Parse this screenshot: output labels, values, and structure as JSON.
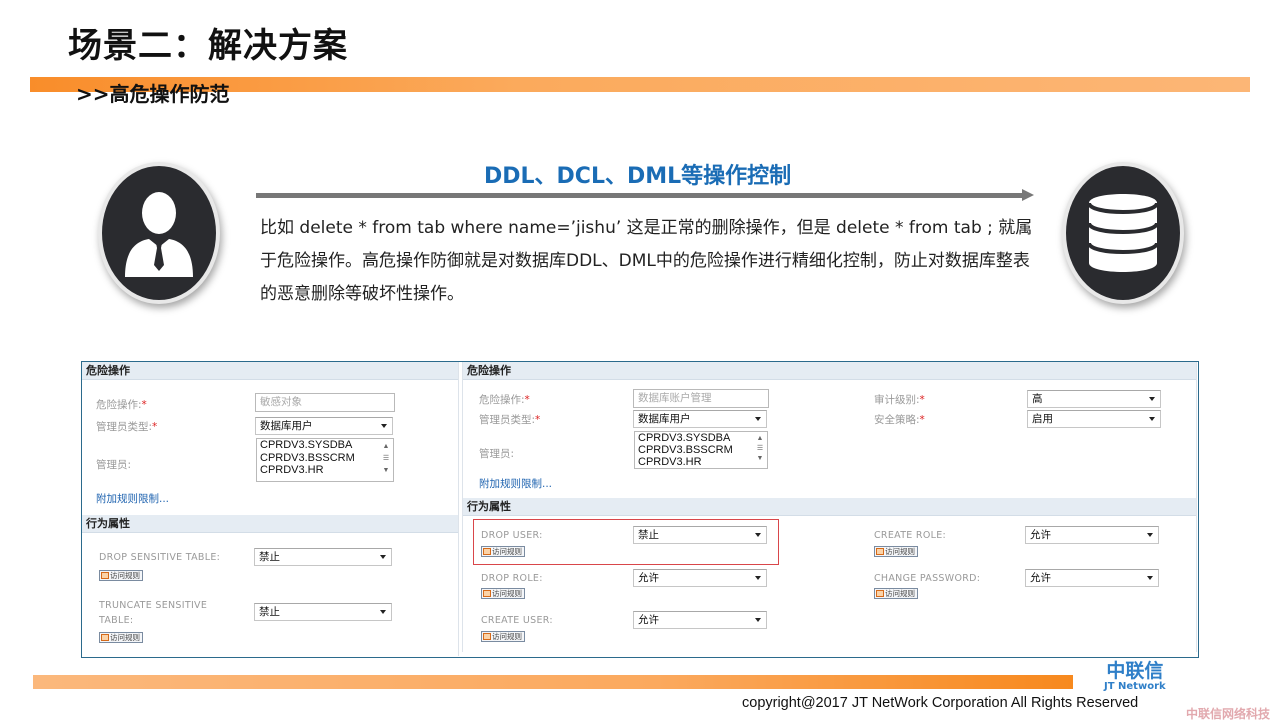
{
  "slide": {
    "title": "场景二：解决方案",
    "subtitle": ">>高危操作防范",
    "flow_title": "DDL、DCL、DML等操作控制",
    "description": "比如 delete * from tab where name=’jishu’ 这是正常的删除操作，但是 delete * from tab ; 就属于危险操作。高危操作防御就是对数据库DDL、DML中的危险操作进行精细化控制，防止对数据库整表的恶意删除等破坏性操作。",
    "left_icon": "user-icon",
    "right_icon": "database-icon"
  },
  "left_panel": {
    "section1_title": "危险操作",
    "fields": {
      "danger_op_label": "危险操作:",
      "danger_op_placeholder": "敏感对象",
      "admin_type_label": "管理员类型:",
      "admin_type_value": "数据库用户",
      "admin_label": "管理员:",
      "admin_options": [
        "CPRDV3.SYSDBA",
        "CPRDV3.BSSCRM",
        "CPRDV3.HR"
      ]
    },
    "extra_rule_link": "附加规则限制...",
    "section2_title": "行为属性",
    "behaviors": [
      {
        "label": "DROP SENSITIVE TABLE:",
        "value": "禁止",
        "rule_button": "访问规则"
      },
      {
        "label": "TRUNCATE SENSITIVE TABLE:",
        "value": "禁止",
        "rule_button": "访问规则"
      }
    ]
  },
  "right_panel": {
    "section1_title": "危险操作",
    "fields": {
      "danger_op_label": "危险操作:",
      "danger_op_value": "数据库账户管理",
      "admin_type_label": "管理员类型:",
      "admin_type_value": "数据库用户",
      "admin_label": "管理员:",
      "admin_options": [
        "CPRDV3.SYSDBA",
        "CPRDV3.BSSCRM",
        "CPRDV3.HR"
      ],
      "audit_level_label": "审计级别:",
      "audit_level_value": "高",
      "security_policy_label": "安全策略:",
      "security_policy_value": "启用"
    },
    "extra_rule_link": "附加规则限制...",
    "section2_title": "行为属性",
    "behaviors": [
      {
        "label": "DROP USER:",
        "value": "禁止",
        "rule_button": "访问规则",
        "highlighted": true
      },
      {
        "label": "DROP ROLE:",
        "value": "允许",
        "rule_button": "访问规则"
      },
      {
        "label": "CREATE USER:",
        "value": "允许",
        "rule_button": "访问规则"
      },
      {
        "label": "CREATE ROLE:",
        "value": "允许",
        "rule_button": "访问规则"
      },
      {
        "label": "CHANGE PASSWORD:",
        "value": "允许",
        "rule_button": "访问规则"
      }
    ]
  },
  "footer": {
    "logo_cn": "中联信",
    "logo_en": "JT Network",
    "copyright": "copyright@2017  JT NetWork Corporation All Rights Reserved",
    "watermark": "中联信网络科技"
  },
  "colors": {
    "accent_orange": "#f98d2a",
    "title_blue": "#1a6cb5",
    "highlight_red": "#d9464a",
    "link_blue": "#2064b0"
  }
}
